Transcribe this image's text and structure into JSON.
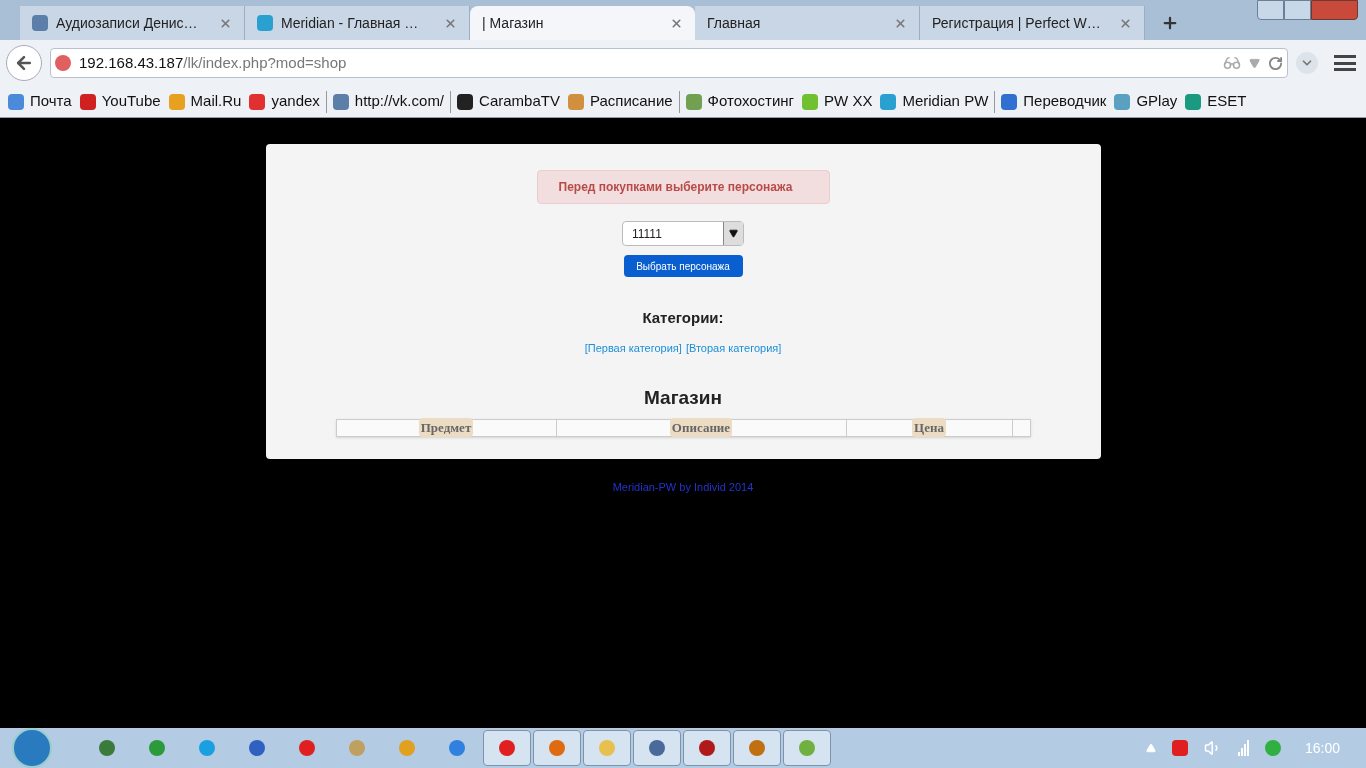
{
  "tabs": [
    {
      "title": "Аудиозаписи Денис…",
      "selected": false
    },
    {
      "title": "Meridian - Главная …",
      "selected": false
    },
    {
      "title": "| Магазин",
      "selected": true
    },
    {
      "title": "Главная",
      "selected": false
    },
    {
      "title": "Регистрация | Perfect W…",
      "selected": false
    }
  ],
  "address": {
    "host": "192.168.43.187",
    "path": "/lk/index.php?mod=shop"
  },
  "bookmarks": [
    {
      "label": "Почта",
      "separator_after": false
    },
    {
      "label": "YouTube",
      "separator_after": false
    },
    {
      "label": "Mail.Ru",
      "separator_after": false
    },
    {
      "label": "yandex",
      "separator_after": true
    },
    {
      "label": "http://vk.com/",
      "separator_after": true
    },
    {
      "label": "CarambaTV",
      "separator_after": false
    },
    {
      "label": "Расписание",
      "separator_after": true
    },
    {
      "label": "Фотохостинг",
      "separator_after": false
    },
    {
      "label": "PW XX",
      "separator_after": false
    },
    {
      "label": "Meridian PW",
      "separator_after": true
    },
    {
      "label": "Переводчик",
      "separator_after": false
    },
    {
      "label": "GPlay",
      "separator_after": false
    },
    {
      "label": "ESET",
      "separator_after": false
    }
  ],
  "alert": "Перед покупками выберите персонажа",
  "character_select": {
    "value": "11111"
  },
  "select_button": "Выбрать персонажа",
  "categories": {
    "title": "Категории:",
    "links": [
      "[Первая категория]",
      "[Вторая категория]"
    ]
  },
  "shop": {
    "title": "Магазин",
    "columns": [
      "Предмет",
      "Описание",
      "Цена"
    ]
  },
  "footer": "Meridian-PW by Individ 2014",
  "taskbar": {
    "apps": [
      {
        "running": false
      },
      {
        "running": false
      },
      {
        "running": false
      },
      {
        "running": false
      },
      {
        "running": false
      },
      {
        "running": false
      },
      {
        "running": false
      },
      {
        "running": false
      },
      {
        "running": true
      },
      {
        "running": true
      },
      {
        "running": true
      },
      {
        "running": true
      },
      {
        "running": true
      },
      {
        "running": true
      },
      {
        "running": true
      }
    ],
    "clock": "16:00"
  }
}
